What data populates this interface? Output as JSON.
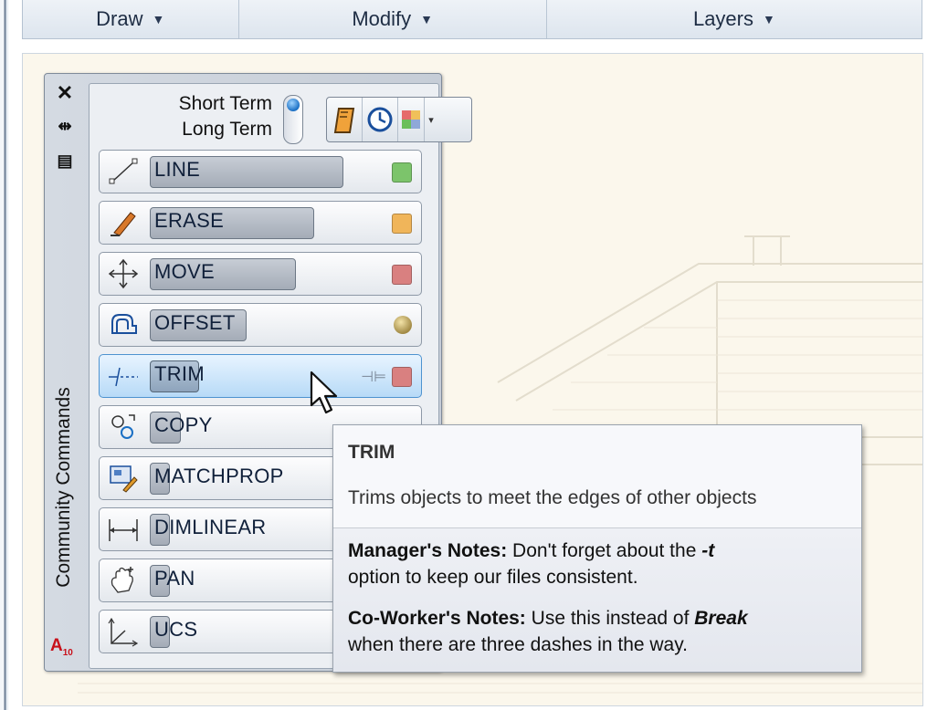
{
  "ribbon": {
    "panels": [
      {
        "label": "Draw",
        "width": 236
      },
      {
        "label": "Modify",
        "width": 337
      },
      {
        "label": "Layers",
        "width": 411
      }
    ]
  },
  "palette": {
    "name": "Community Commands",
    "switch": {
      "top_label": "Short Term",
      "bottom_label": "Long Term"
    },
    "commands": [
      {
        "name": "LINE",
        "icon": "line-icon",
        "swatch": "#7cc46b"
      },
      {
        "name": "ERASE",
        "icon": "erase-icon",
        "swatch": "#f0b55a"
      },
      {
        "name": "MOVE",
        "icon": "move-icon",
        "swatch": "#d98080"
      },
      {
        "name": "OFFSET",
        "icon": "offset-icon",
        "swatch": "sphere"
      },
      {
        "name": "TRIM",
        "icon": "trim-icon",
        "swatch": "#d98080"
      },
      {
        "name": "COPY",
        "icon": "copy-icon",
        "swatch": "#d98080"
      },
      {
        "name": "MATCHPROP",
        "icon": "matchprop-icon",
        "swatch": ""
      },
      {
        "name": "DIMLINEAR",
        "icon": "dimlinear-icon",
        "swatch": ""
      },
      {
        "name": "PAN",
        "icon": "pan-icon",
        "swatch": ""
      },
      {
        "name": "UCS",
        "icon": "ucs-icon",
        "swatch": ""
      }
    ]
  },
  "tooltip": {
    "title": "TRIM",
    "description": "Trims objects to meet the edges of other objects",
    "manager_label": "Manager's Notes:",
    "manager_text_1": " Don't forget about the ",
    "manager_flag": "-t",
    "manager_text_2": "option to keep our files consistent.",
    "coworker_label": "Co-Worker's Notes:",
    "coworker_text_1": " Use this instead of ",
    "coworker_em": "Break",
    "coworker_text_2": "when there are three dashes in the way."
  },
  "colors": {
    "accent": "#4e93d0",
    "logo": "#c8101a"
  }
}
